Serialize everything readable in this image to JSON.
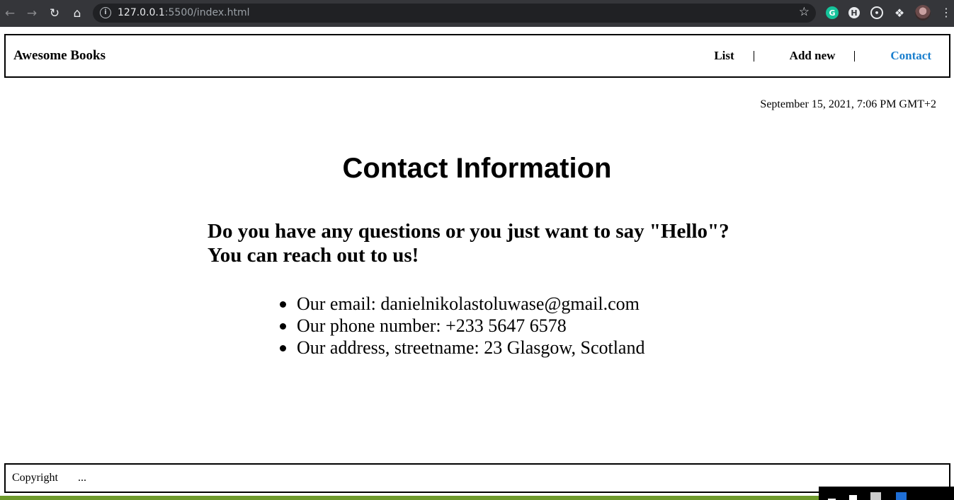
{
  "browser": {
    "url_host": "127.0.0.1",
    "url_rest": ":5500/index.html",
    "icons": [
      "back-arrow-icon",
      "forward-arrow-icon",
      "reload-icon",
      "home-icon",
      "info-icon",
      "star-icon",
      "grammarly-icon",
      "extension-icon",
      "tracking-icon",
      "puzzle-icon",
      "avatar",
      "kebab-menu-icon"
    ],
    "grammarly_letter": "G",
    "ext_letter": "H"
  },
  "header": {
    "brand": "Awesome Books",
    "menu": [
      {
        "label": "List",
        "active": false
      },
      {
        "label": "Add new",
        "active": false
      },
      {
        "label": "Contact",
        "active": true
      }
    ],
    "active_color": "#1a7fce"
  },
  "date": "September 15, 2021, 7:06 PM GMT+2",
  "contact": {
    "title": "Contact Information",
    "lead_line1": "Do you have any questions or you just want to say \"Hello\"?",
    "lead_line2": "You can reach out to us!",
    "items": [
      "Our email: danielnikolastoluwase@gmail.com",
      "Our phone number: +233 5647 6578",
      "Our address, streetname: 23 Glasgow, Scotland"
    ]
  },
  "footer": {
    "copyright": "Copyright",
    "dots": "..."
  }
}
